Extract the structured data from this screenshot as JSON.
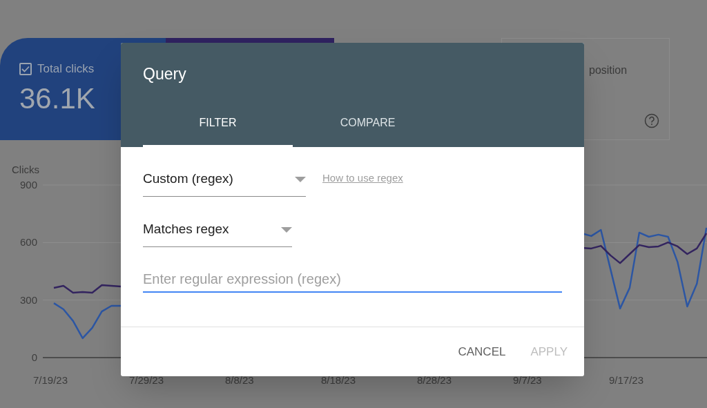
{
  "metric_cards": [
    {
      "selected": true,
      "color": "#21427d",
      "checked": true,
      "label": "Total clicks",
      "value": "36.1K"
    },
    {
      "selected": true,
      "color": "#2f2260"
    },
    {
      "selected": false,
      "label": "position"
    }
  ],
  "chart": {
    "axis_title": "Clicks",
    "y_labels": [
      "900",
      "600",
      "300",
      "0"
    ],
    "x_labels": [
      "7/19/23",
      "7/29/23",
      "8/8/23",
      "8/18/23",
      "8/28/23",
      "9/7/23",
      "9/17/23"
    ]
  },
  "dialog": {
    "title": "Query",
    "tabs": [
      {
        "label": "FILTER",
        "selected": true
      },
      {
        "label": "COMPARE",
        "selected": false
      }
    ],
    "selects": [
      {
        "value": "Custom (regex)"
      },
      {
        "value": "Matches regex"
      }
    ],
    "link": "How to use regex",
    "input": {
      "placeholder": "Enter regular expression (regex)"
    },
    "buttons": [
      {
        "label": "CANCEL",
        "disabled": false
      },
      {
        "label": "APPLY",
        "disabled": true
      }
    ]
  }
}
